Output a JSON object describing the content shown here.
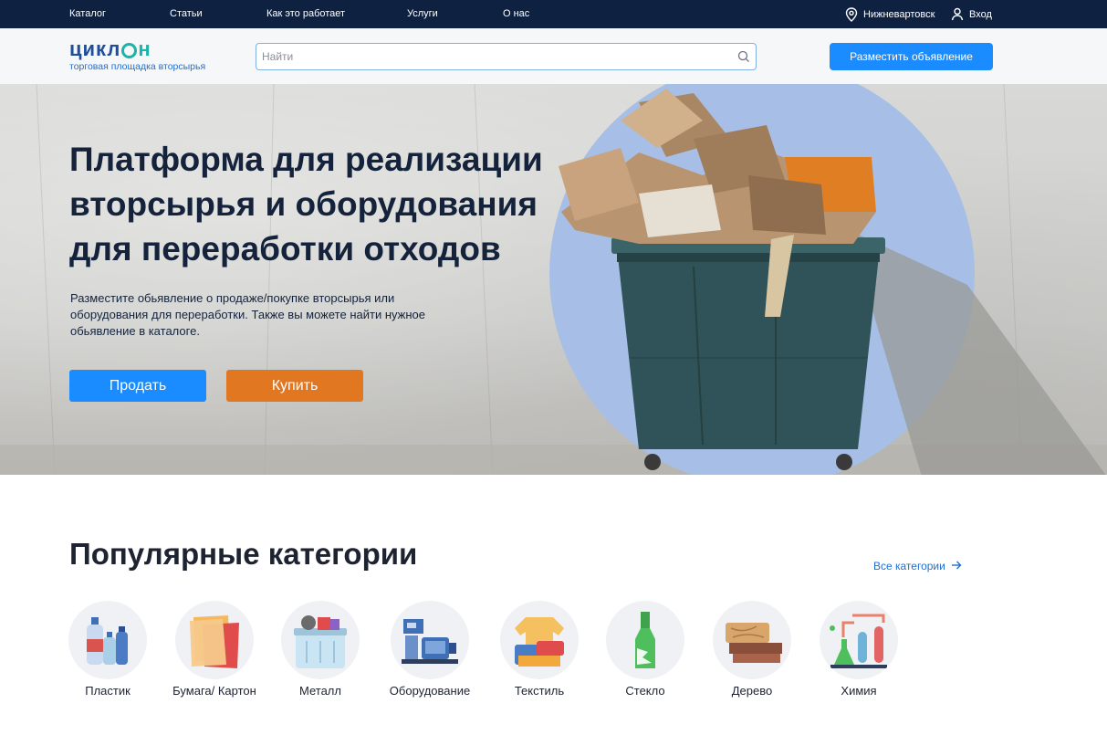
{
  "topnav": {
    "items": [
      "Каталог",
      "Статьи",
      "Как это работает",
      "Услуги",
      "О нас"
    ],
    "city": "Нижневартовск",
    "login": "Вход"
  },
  "header": {
    "logo_main": "цикл",
    "logo_tail": "н",
    "logo_sub": "торговая площадка вторсырья",
    "search_placeholder": "Найти",
    "post_button": "Разместить объявление"
  },
  "hero": {
    "title": "Платформа для реализации вторсырья и оборудования для переработки отходов",
    "description": "Разместите обьявление о продаже/покупке вторсырья или оборудования для переработки. Также вы можете найти нужное обьявление в каталоге.",
    "sell_button": "Продать",
    "buy_button": "Купить"
  },
  "categories": {
    "title": "Популярные категории",
    "all_link": "Все категории",
    "items": [
      {
        "label": "Пластик",
        "icon": "plastic-bottles-icon"
      },
      {
        "label": "Бумага/ Картон",
        "icon": "paper-icon"
      },
      {
        "label": "Металл",
        "icon": "metal-bin-icon"
      },
      {
        "label": "Оборудование",
        "icon": "equipment-icon"
      },
      {
        "label": "Текстиль",
        "icon": "textile-icon"
      },
      {
        "label": "Стекло",
        "icon": "glass-bottle-icon"
      },
      {
        "label": "Дерево",
        "icon": "wood-icon"
      },
      {
        "label": "Химия",
        "icon": "chemistry-icon"
      }
    ]
  },
  "colors": {
    "navy": "#0f2140",
    "primary": "#1a8cff",
    "orange": "#e27722",
    "teal": "#1bb4a8"
  }
}
